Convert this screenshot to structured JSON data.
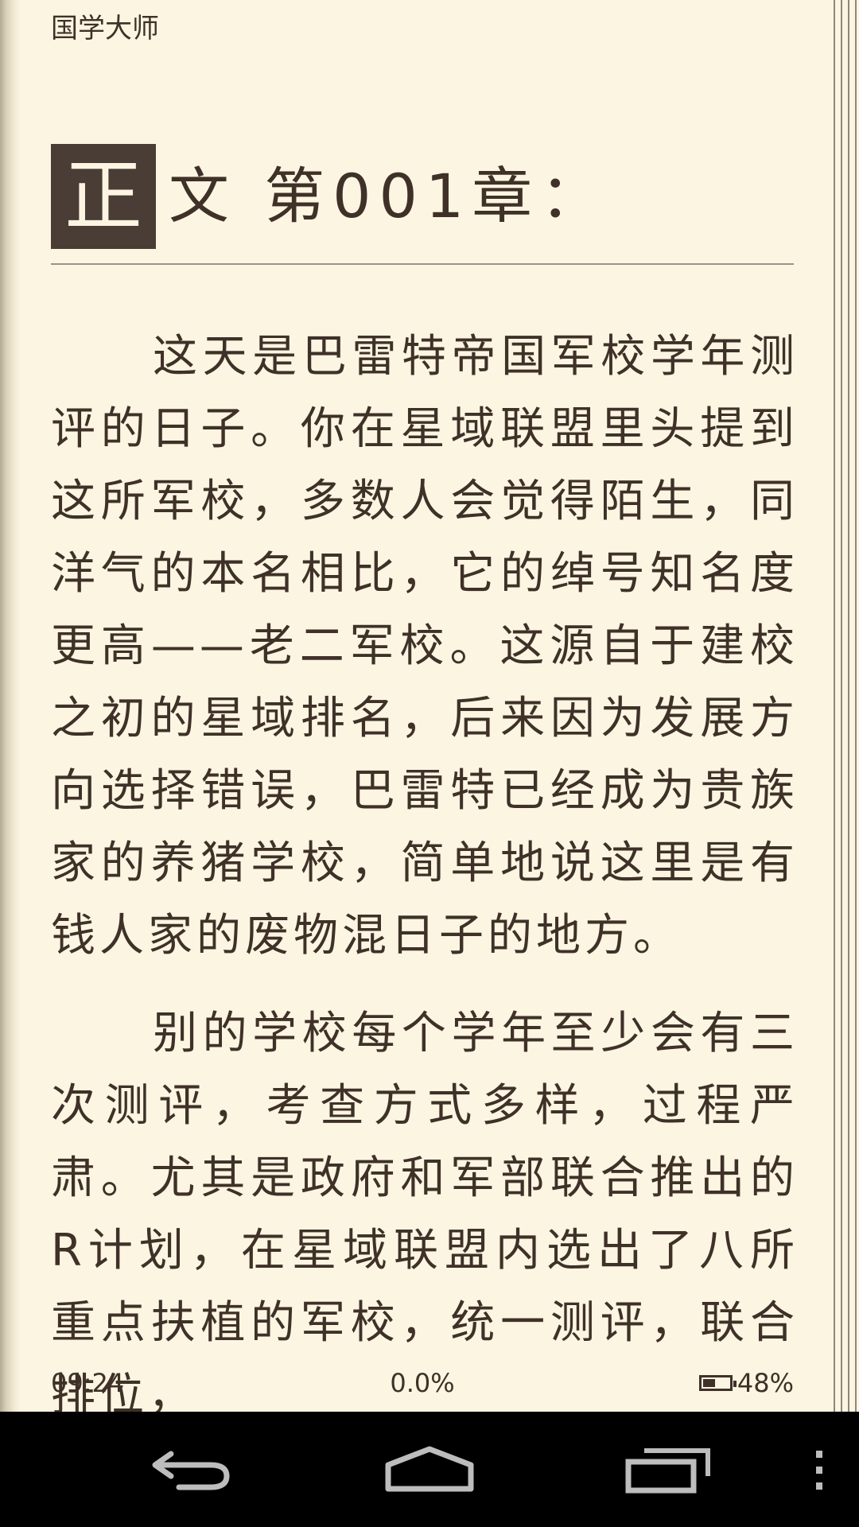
{
  "header": {
    "book_title": "国学大师"
  },
  "chapter": {
    "drop_char": "正",
    "title_rest": "文 第001章："
  },
  "paragraphs": [
    "这天是巴雷特帝国军校学年测评的日子。你在星域联盟里头提到这所军校，多数人会觉得陌生，同洋气的本名相比，它的绰号知名度更高——老二军校。这源自于建校之初的星域排名，后来因为发展方向选择错误，巴雷特已经成为贵族家的养猪学校，简单地说这里是有钱人家的废物混日子的地方。",
    "别的学校每个学年至少会有三次测评，考查方式多样，过程严肃。尤其是政府和军部联合推出的R计划，在星域联盟内选出了八所重点扶植的军校，统一测评，联合排位，"
  ],
  "status": {
    "time": "09:24",
    "progress": "0.0%",
    "battery": "48%",
    "battery_level": 0.48
  },
  "navbar": {
    "back": "back-icon",
    "home": "home-icon",
    "recents": "recents-icon",
    "menu": "menu-icon"
  },
  "colors": {
    "page_bg": "#fcf5e2",
    "text": "#3f3128",
    "drop_box": "#4a3d35",
    "navbar_bg": "#000000"
  }
}
